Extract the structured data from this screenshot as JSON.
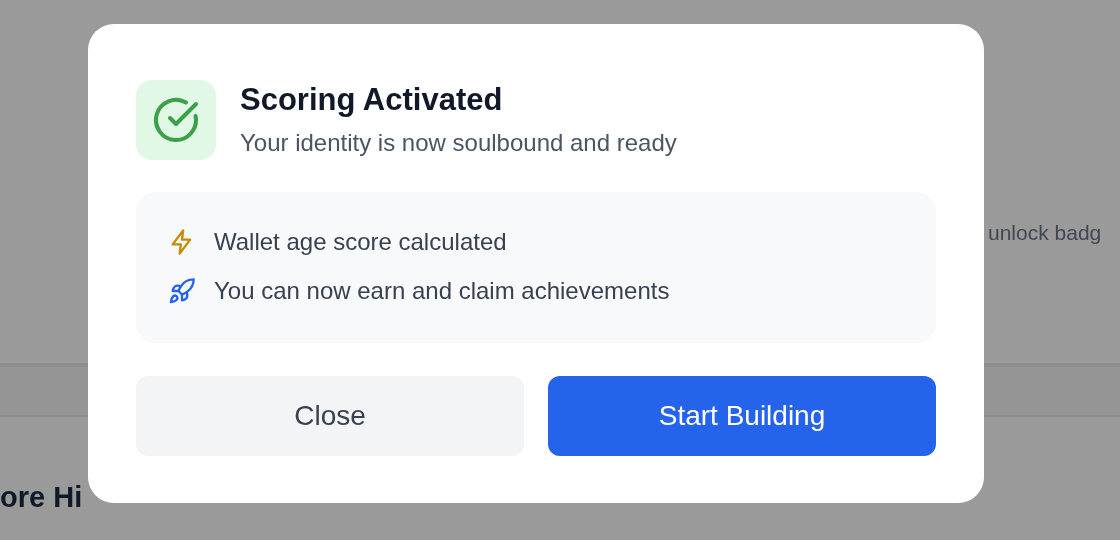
{
  "background": {
    "side_text": "unlock badg",
    "heading": "ore Hi"
  },
  "dialog": {
    "title": "Scoring Activated",
    "subtitle": "Your identity is now soulbound and ready",
    "items": [
      {
        "kind": "bolt",
        "text": "Wallet age score calculated"
      },
      {
        "kind": "rocket",
        "text": "You can now earn and claim achievements"
      }
    ],
    "buttons": [
      {
        "kind": "secondary",
        "label": "Close"
      },
      {
        "kind": "primary",
        "label": "Start Building"
      }
    ]
  }
}
